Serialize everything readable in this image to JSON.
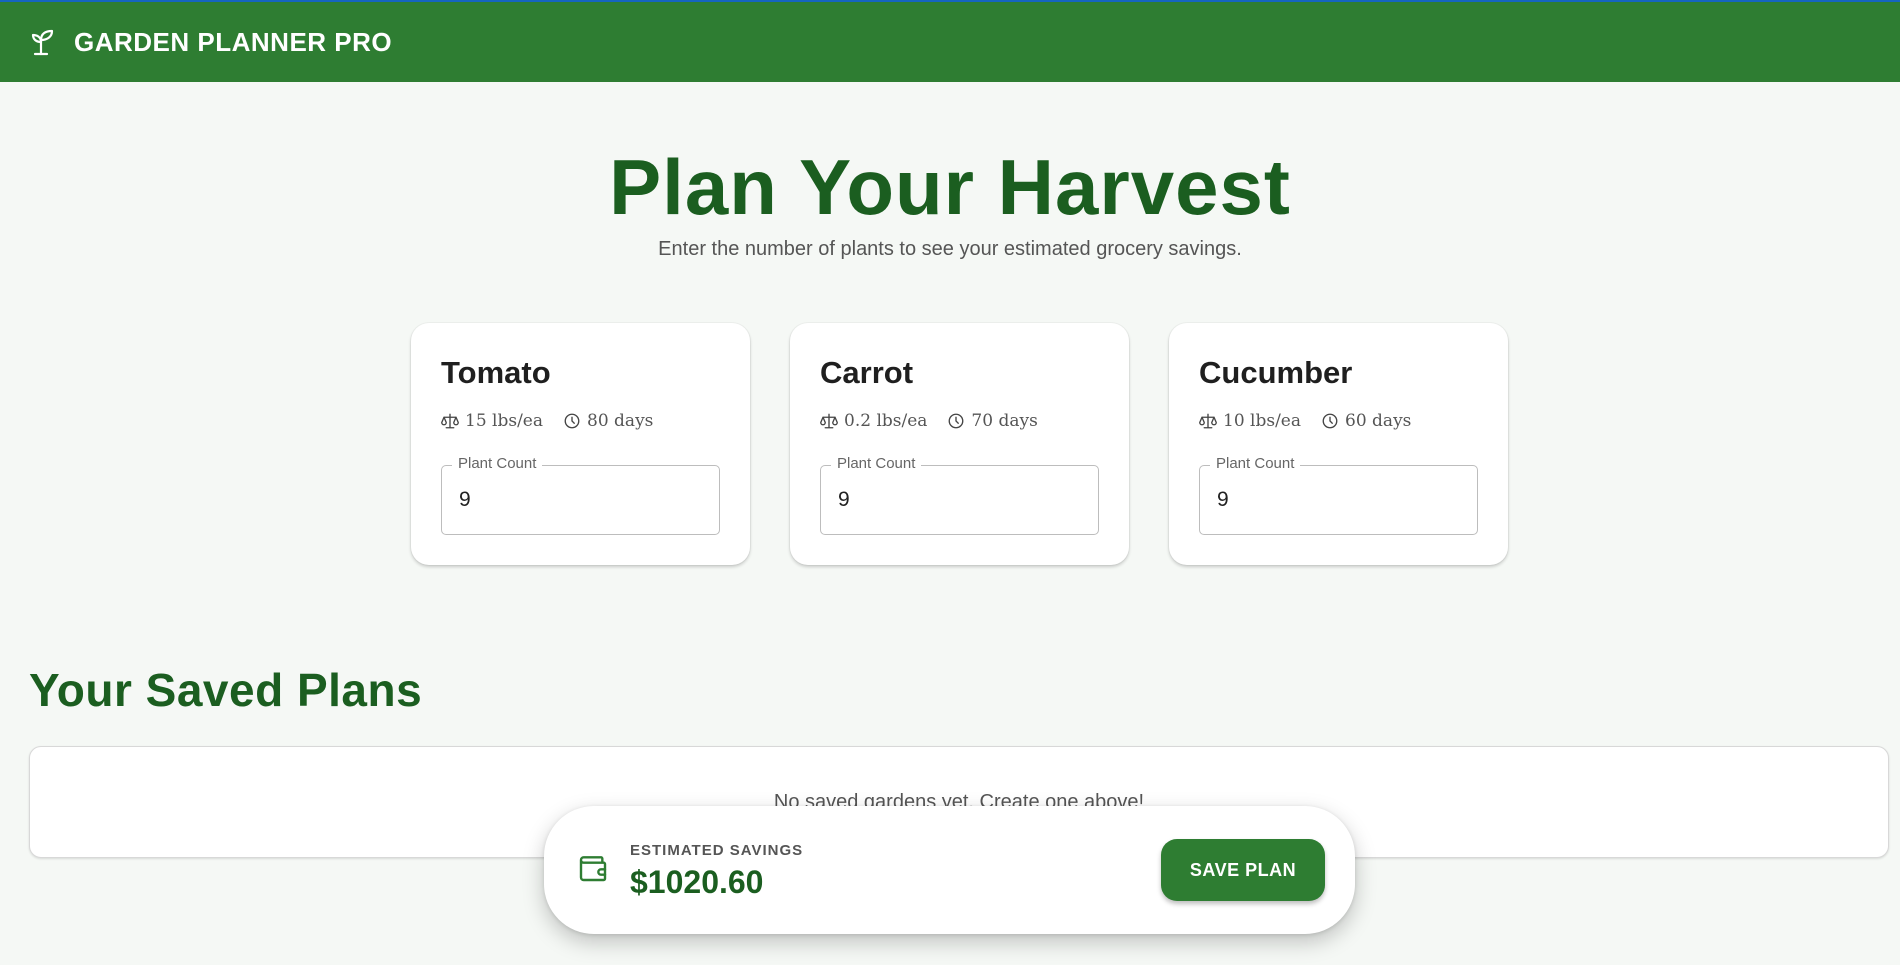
{
  "appbar": {
    "title": "GARDEN PLANNER PRO",
    "icon": "sprout-icon"
  },
  "hero": {
    "title": "Plan Your Harvest",
    "subtitle": "Enter the number of plants to see your estimated grocery savings."
  },
  "plants": [
    {
      "name": "Tomato",
      "yield": "15 lbs/ea",
      "days": "80 days",
      "field_label": "Plant Count",
      "count": "9"
    },
    {
      "name": "Carrot",
      "yield": "0.2 lbs/ea",
      "days": "70 days",
      "field_label": "Plant Count",
      "count": "9"
    },
    {
      "name": "Cucumber",
      "yield": "10 lbs/ea",
      "days": "60 days",
      "field_label": "Plant Count",
      "count": "9"
    }
  ],
  "saved": {
    "title": "Your Saved Plans",
    "empty_text": "No saved gardens yet. Create one above!"
  },
  "savings": {
    "label": "ESTIMATED SAVINGS",
    "amount": "$1020.60",
    "save_label": "SAVE PLAN",
    "icon": "wallet-icon"
  },
  "colors": {
    "primary": "#2e7d32",
    "heading": "#1b5e20",
    "background": "#f5f8f5"
  }
}
